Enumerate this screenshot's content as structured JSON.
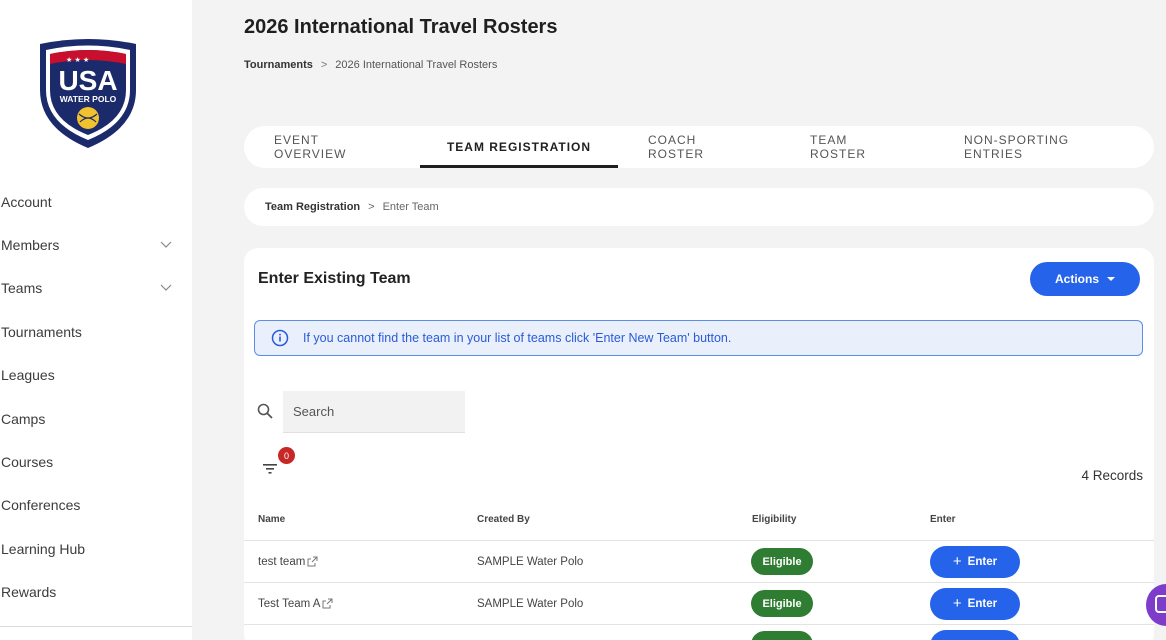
{
  "brand": {
    "logo_text_main": "USA",
    "logo_text_sub": "WATER POLO",
    "colors": {
      "navy": "#1b2a6b",
      "red": "#c8102e",
      "gold": "#f2c12e"
    }
  },
  "sidebar": {
    "items": [
      {
        "label": "Account",
        "has_chevron": false
      },
      {
        "label": "Members",
        "has_chevron": true
      },
      {
        "label": "Teams",
        "has_chevron": true
      },
      {
        "label": "Tournaments",
        "has_chevron": false
      },
      {
        "label": "Leagues",
        "has_chevron": false
      },
      {
        "label": "Camps",
        "has_chevron": false
      },
      {
        "label": "Courses",
        "has_chevron": false
      },
      {
        "label": "Conferences",
        "has_chevron": false
      },
      {
        "label": "Learning Hub",
        "has_chevron": false
      },
      {
        "label": "Rewards",
        "has_chevron": false
      }
    ]
  },
  "header": {
    "title": "2026 International Travel Rosters",
    "breadcrumb": {
      "parent": "Tournaments",
      "separator": ">",
      "current": "2026 International Travel Rosters"
    }
  },
  "tabs": [
    {
      "label": "EVENT OVERVIEW",
      "active": false
    },
    {
      "label": "TEAM REGISTRATION",
      "active": true
    },
    {
      "label": "COACH ROSTER",
      "active": false
    },
    {
      "label": "TEAM ROSTER",
      "active": false
    },
    {
      "label": "NON-SPORTING ENTRIES",
      "active": false
    }
  ],
  "subcrumb": {
    "parent": "Team Registration",
    "separator": ">",
    "current": "Enter Team"
  },
  "card": {
    "title": "Enter Existing Team",
    "actions_label": "Actions",
    "info_message": "If you cannot find the team in your list of teams click 'Enter New Team' button.",
    "search_placeholder": "Search",
    "filter_count": "0",
    "records_label": "4 Records",
    "columns": {
      "name": "Name",
      "created_by": "Created By",
      "eligibility": "Eligibility",
      "enter": "Enter"
    },
    "rows": [
      {
        "name": "test team",
        "created_by": "SAMPLE Water Polo",
        "eligibility": "Eligible",
        "enter": "Enter"
      },
      {
        "name": "Test Team A",
        "created_by": "SAMPLE Water Polo",
        "eligibility": "Eligible",
        "enter": "Enter"
      }
    ]
  },
  "colors": {
    "primary": "#2563eb",
    "eligible": "#2e7d32",
    "badge": "#c62828",
    "info_bg": "#e9f0fc"
  }
}
